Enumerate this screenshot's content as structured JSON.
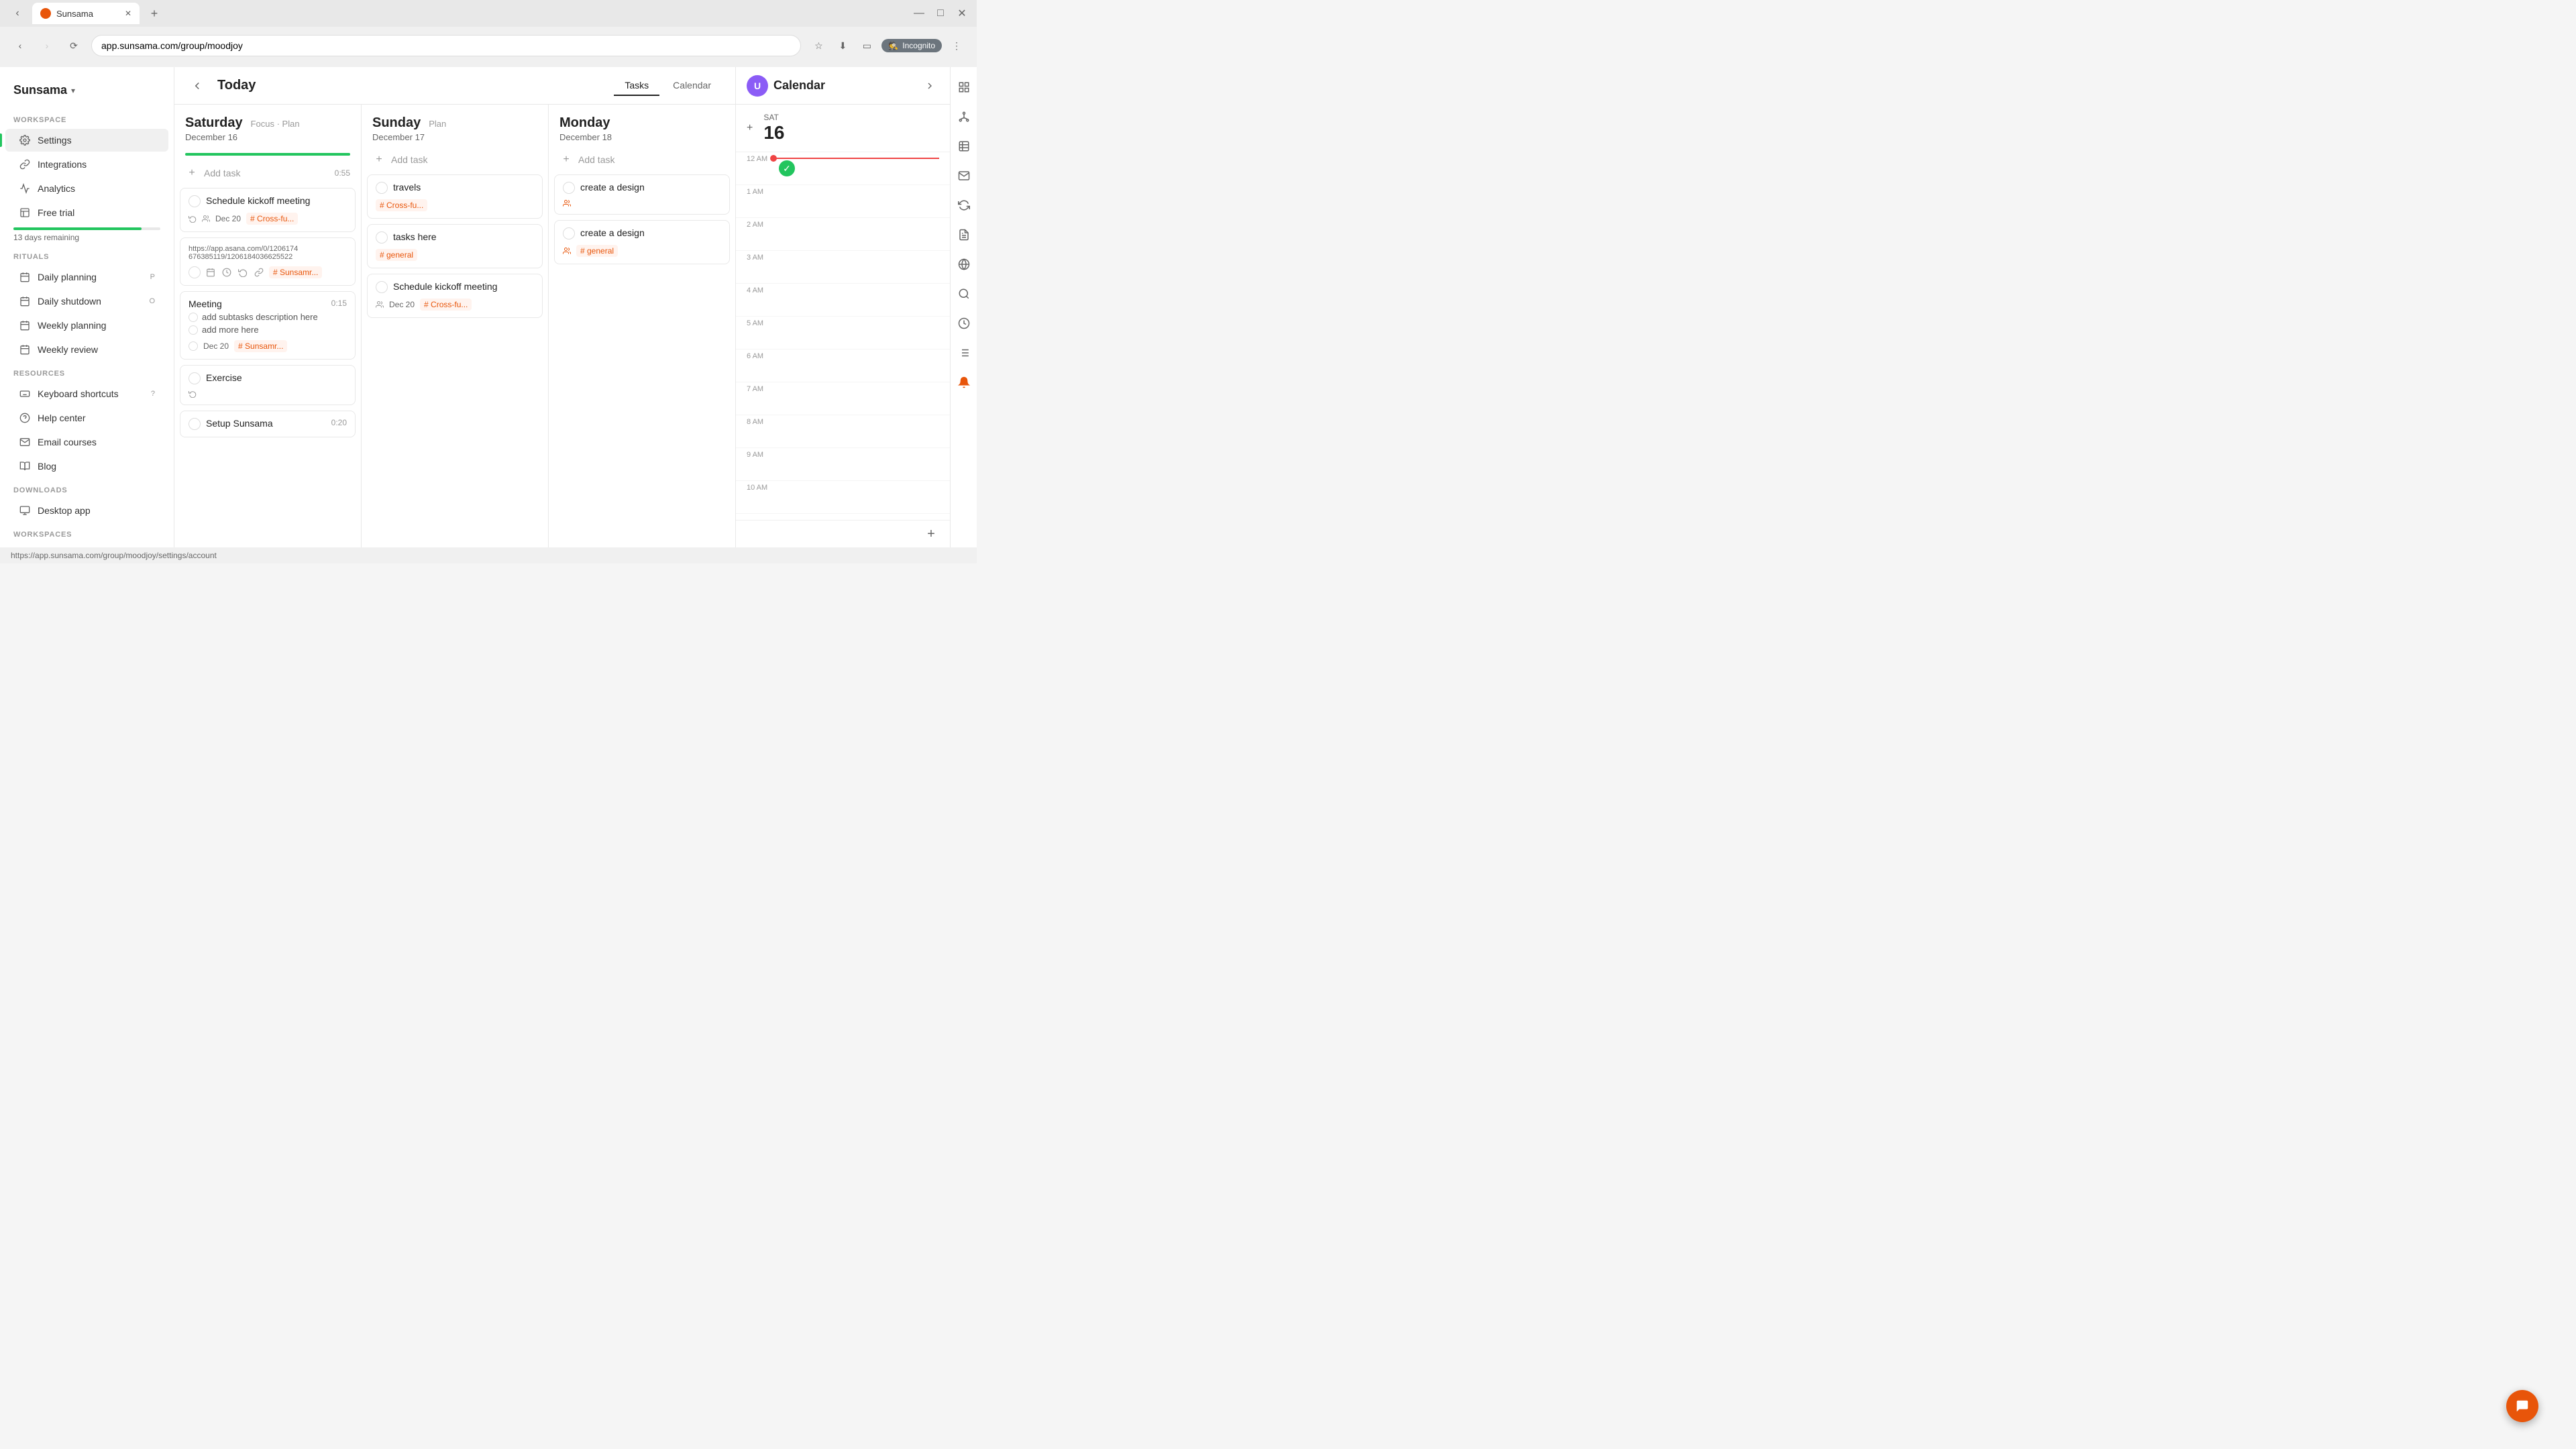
{
  "browser": {
    "tab_title": "Sunsama",
    "url": "app.sunsama.com/group/moodjoy",
    "new_tab_label": "+",
    "incognito_label": "Incognito"
  },
  "sidebar": {
    "app_name": "Sunsama",
    "sections": {
      "workspace": {
        "label": "WORKSPACE",
        "items": [
          {
            "id": "settings",
            "label": "Settings",
            "icon": "gear"
          },
          {
            "id": "integrations",
            "label": "Integrations",
            "icon": "link"
          },
          {
            "id": "analytics",
            "label": "Analytics",
            "icon": "chart"
          },
          {
            "id": "free-trial",
            "label": "Free trial",
            "icon": "gift"
          }
        ]
      },
      "rituals": {
        "label": "RITUALS",
        "items": [
          {
            "id": "daily-planning",
            "label": "Daily planning",
            "badge": "P",
            "icon": "sun"
          },
          {
            "id": "daily-shutdown",
            "label": "Daily shutdown",
            "badge": "O",
            "icon": "moon"
          },
          {
            "id": "weekly-planning",
            "label": "Weekly planning",
            "badge": "",
            "icon": "calendar"
          },
          {
            "id": "weekly-review",
            "label": "Weekly review",
            "badge": "",
            "icon": "refresh"
          }
        ]
      },
      "resources": {
        "label": "RESOURCES",
        "items": [
          {
            "id": "keyboard-shortcuts",
            "label": "Keyboard shortcuts",
            "badge": "?",
            "icon": "keyboard"
          },
          {
            "id": "help-center",
            "label": "Help center",
            "badge": "",
            "icon": "question"
          },
          {
            "id": "email-courses",
            "label": "Email courses",
            "badge": "",
            "icon": "email"
          },
          {
            "id": "blog",
            "label": "Blog",
            "badge": "",
            "icon": "book"
          }
        ]
      },
      "downloads": {
        "label": "DOWNLOADS",
        "items": [
          {
            "id": "desktop-app",
            "label": "Desktop app",
            "badge": "",
            "icon": "desktop"
          }
        ]
      },
      "workspaces": {
        "label": "WORKSPACES"
      }
    },
    "free_trial_days": "13 days remaining",
    "free_trial_progress": 87
  },
  "header": {
    "title": "Today",
    "tabs": [
      "Tasks",
      "Calendar"
    ],
    "active_tab": "Tasks"
  },
  "days": [
    {
      "name": "Saturday",
      "date": "December 16",
      "actions": [
        "Focus",
        "Plan"
      ],
      "progress_width": "60%",
      "add_task_label": "Add task",
      "add_task_time": "0:55",
      "tasks": [
        {
          "id": "t1",
          "title": "Schedule kickoff meeting",
          "date": "Dec 20",
          "tag": "Cross-fu...",
          "checked": false,
          "has_recur": true,
          "has_people": true
        },
        {
          "id": "t2",
          "url": "https://app.asana.com/0/120617467638511​9/1206184036625522",
          "has_check": true,
          "has_calendar": true,
          "has_clock": true,
          "has_recur": true,
          "has_link": true,
          "tag": "Sunsamr..."
        },
        {
          "id": "t3",
          "title": "Meeting",
          "time": "0:15",
          "subtasks": [
            "add subtasks description here",
            "add more here"
          ],
          "date": "Dec 20",
          "tag": "Sunsamr...",
          "checked": false
        },
        {
          "id": "t4",
          "title": "Exercise",
          "checked": false,
          "has_recur": true
        },
        {
          "id": "t5",
          "title": "Setup Sunsama",
          "time": "0:20",
          "checked": false
        }
      ]
    },
    {
      "name": "Sunday",
      "date": "December 17",
      "actions": [
        "Plan"
      ],
      "progress_width": "0%",
      "add_task_label": "Add task",
      "tasks": [
        {
          "id": "s1",
          "title": "travels",
          "tag": "Cross-fu...",
          "checked": false,
          "has_people": false
        },
        {
          "id": "s2",
          "title": "tasks here",
          "tag": "general",
          "checked": false
        },
        {
          "id": "s3",
          "title": "Schedule kickoff meeting",
          "date": "Dec 20",
          "tag": "Cross-fu...",
          "checked": false,
          "has_people": true
        }
      ]
    },
    {
      "name": "Monday",
      "date": "December 18",
      "actions": [],
      "progress_width": "0%",
      "add_task_label": "Add task",
      "tasks": [
        {
          "id": "m1",
          "title": "create a design",
          "checked": false,
          "has_people": true
        },
        {
          "id": "m2",
          "title": "create a design",
          "tag": "general",
          "checked": false,
          "has_people": true
        }
      ]
    }
  ],
  "calendar": {
    "title": "Calendar",
    "day_name": "SAT",
    "day_num": "16",
    "times": [
      "12 AM",
      "1 AM",
      "2 AM",
      "3 AM",
      "4 AM",
      "5 AM",
      "6 AM",
      "7 AM",
      "8 AM",
      "9 AM",
      "10 AM"
    ]
  },
  "status_bar": {
    "url": "https://app.sunsama.com/group/moodjoy/settings/account"
  },
  "fab": {
    "icon": "chat"
  }
}
